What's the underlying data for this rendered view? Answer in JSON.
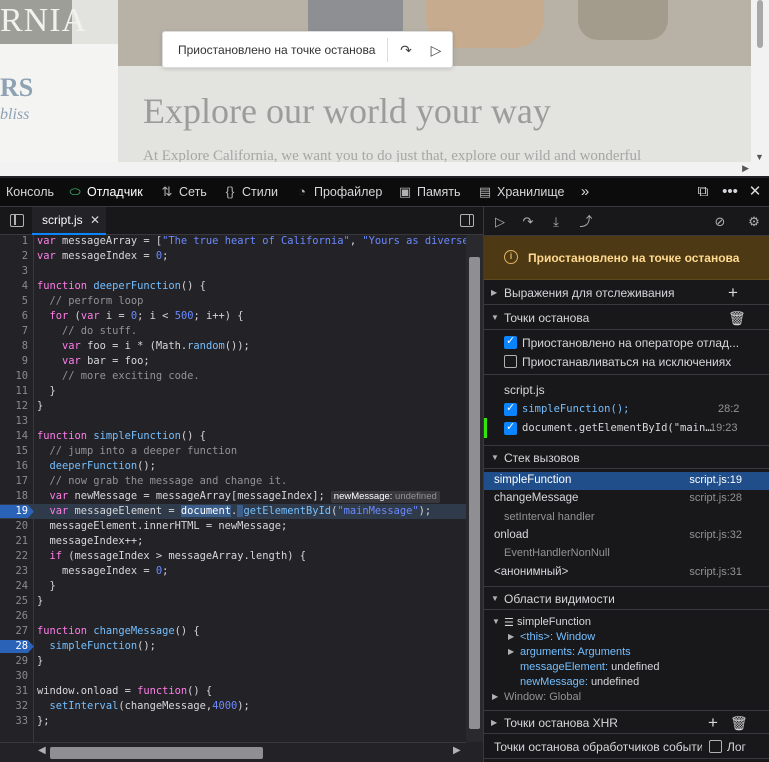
{
  "page": {
    "logo_text": "RNIA",
    "side_rs": "RS",
    "side_bliss": "bliss",
    "headline": "Explore our world your way",
    "intro": "At Explore California, we want you to do just that, explore our wild and wonderful",
    "paused_overlay": {
      "text": "Приостановлено на точке останова",
      "step_icon": "step-over-icon",
      "resume_icon": "play-icon"
    }
  },
  "toolbox": {
    "tabs": [
      {
        "label": "Консоль",
        "icon": "console-icon"
      },
      {
        "label": "Отладчик",
        "icon": "debugger-icon",
        "active": true
      },
      {
        "label": "Сеть",
        "icon": "network-icon"
      },
      {
        "label": "Стили",
        "icon": "style-editor-icon"
      },
      {
        "label": "Профайлер",
        "icon": "profiler-icon"
      },
      {
        "label": "Память",
        "icon": "memory-icon"
      },
      {
        "label": "Хранилище",
        "icon": "storage-icon"
      }
    ],
    "more_icon": "chevron-double-right-icon",
    "right_icons": [
      "responsive-design-icon",
      "meatball-menu-icon",
      "close-icon"
    ]
  },
  "source": {
    "file_tab": "script.js",
    "lines": [
      {
        "n": "1",
        "html": "<span class=\"kw\">var</span> messageArray = [<span class=\"str\">\"The true heart of California\"</span>, <span class=\"str\">\"Yours as diverse as</span>"
      },
      {
        "n": "2",
        "html": "<span class=\"kw\">var</span> messageIndex = <span class=\"num\">0</span>;"
      },
      {
        "n": "3",
        "html": ""
      },
      {
        "n": "4",
        "html": "<span class=\"kw\">function</span> <span class=\"fn\">deeperFunction</span>() {"
      },
      {
        "n": "5",
        "html": "  <span class=\"cm\">// perform loop</span>"
      },
      {
        "n": "6",
        "html": "  <span class=\"kw\">for</span> (<span class=\"kw\">var</span> i = <span class=\"num\">0</span>; i &lt; <span class=\"num\">500</span>; i++) {"
      },
      {
        "n": "7",
        "html": "    <span class=\"cm\">// do stuff.</span>"
      },
      {
        "n": "8",
        "html": "    <span class=\"kw\">var</span> foo = i * (Math.<span class=\"fn\">random</span>());"
      },
      {
        "n": "9",
        "html": "    <span class=\"kw\">var</span> bar = foo;"
      },
      {
        "n": "10",
        "html": "    <span class=\"cm\">// more exciting code.</span>"
      },
      {
        "n": "11",
        "html": "  }"
      },
      {
        "n": "12",
        "html": "}"
      },
      {
        "n": "13",
        "html": ""
      },
      {
        "n": "14",
        "html": "<span class=\"kw\">function</span> <span class=\"fn\">simpleFunction</span>() {"
      },
      {
        "n": "15",
        "html": "  <span class=\"cm\">// jump into a deeper function</span>"
      },
      {
        "n": "16",
        "html": "  <span class=\"fn\">deeperFunction</span>();"
      },
      {
        "n": "17",
        "html": "  <span class=\"cm\">// now grab the message and change it.</span>"
      },
      {
        "n": "18",
        "html": "  <span class=\"kw\">var</span> newMessage = messageArray[messageIndex];<span class=\"preview\"><span class=\"pk\">newMessage:</span> <span class=\"pv\">undefined</span></span>"
      },
      {
        "n": "19",
        "html": "  <span class=\"kw\">var</span> messageElement = <span class=\"hl\">document</span>.<span class=\"hl\"> </span><span class=\"fn\">getElementById</span>(<span class=\"str\">\"mainMessage\"</span>);",
        "bp": true,
        "paused": true
      },
      {
        "n": "20",
        "html": "  messageElement.innerHTML = newMessage;"
      },
      {
        "n": "21",
        "html": "  messageIndex++;"
      },
      {
        "n": "22",
        "html": "  <span class=\"kw\">if</span> (messageIndex &gt; messageArray.length) {"
      },
      {
        "n": "23",
        "html": "    messageIndex = <span class=\"num\">0</span>;"
      },
      {
        "n": "24",
        "html": "  }"
      },
      {
        "n": "25",
        "html": "}"
      },
      {
        "n": "26",
        "html": ""
      },
      {
        "n": "27",
        "html": "<span class=\"kw\">function</span> <span class=\"fn\">changeMessage</span>() {"
      },
      {
        "n": "28",
        "html": "  <span class=\"fn\">simpleFunction</span>();",
        "bp": true
      },
      {
        "n": "29",
        "html": "}"
      },
      {
        "n": "30",
        "html": ""
      },
      {
        "n": "31",
        "html": "window.onload = <span class=\"kw\">function</span>() {"
      },
      {
        "n": "32",
        "html": "  <span class=\"fn\">setInterval</span>(changeMessage,<span class=\"num\">4000</span>);"
      },
      {
        "n": "33",
        "html": "};"
      }
    ]
  },
  "debugger": {
    "commands": [
      "resume-icon",
      "step-over-icon",
      "step-in-icon",
      "step-out-icon"
    ],
    "right_commands": [
      "deactivate-breakpoints-icon",
      "settings-icon"
    ],
    "paused_banner": "Приостановлено на точке останова",
    "watch_label": "Выражения для отслеживания",
    "breakpoints_label": "Точки останова",
    "pause_on_debugger": "Приостановлено на операторе отлад...",
    "pause_on_exceptions": "Приостанавливаться на исключениях",
    "bp_file": "script.js",
    "breakpoints": [
      {
        "text": "simpleFunction();",
        "loc": "28:2"
      },
      {
        "text": "document.getElementById(\"main…",
        "loc": "19:23"
      }
    ],
    "callstack_label": "Стек вызовов",
    "frames": [
      {
        "name": "simpleFunction",
        "loc": "script.js:19",
        "selected": true
      },
      {
        "name": "changeMessage",
        "loc": "script.js:28"
      },
      {
        "group": "setInterval handler"
      },
      {
        "name": "onload",
        "loc": "script.js:32"
      },
      {
        "group": "EventHandlerNonNull"
      },
      {
        "name": "<анонимный>",
        "loc": "script.js:31"
      }
    ],
    "scopes_label": "Области видимости",
    "scope_fn": "simpleFunction",
    "scope_this_key": "<this>:",
    "scope_this_val": "Window",
    "scope_args_key": "arguments:",
    "scope_args_val": "Arguments",
    "scope_msgel_key": "messageElement:",
    "scope_msgel_val": "undefined",
    "scope_newmsg_key": "newMessage:",
    "scope_newmsg_val": "undefined",
    "scope_window": "Window: Global",
    "xhr_label": "Точки останова XHR",
    "event_label": "Точки останова обработчиков событий",
    "event_log": "Лог"
  }
}
